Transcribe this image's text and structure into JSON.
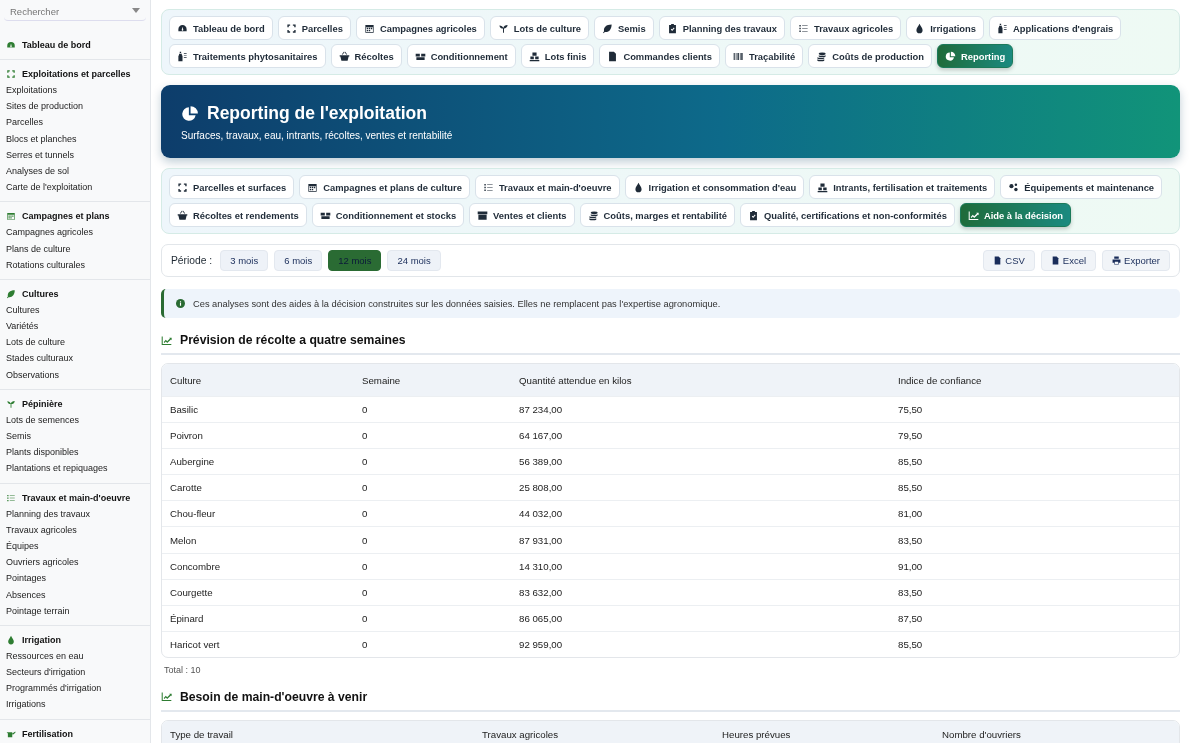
{
  "sidebar": {
    "search": {
      "placeholder": "Rechercher"
    },
    "sections": [
      {
        "title": "Tableau de bord"
      },
      {
        "title": "Exploitations et parcelles",
        "items": [
          "Exploitations",
          "Sites de production",
          "Parcelles",
          "Blocs et planches",
          "Serres et tunnels",
          "Analyses de sol",
          "Carte de l'exploitation"
        ]
      },
      {
        "title": "Campagnes et plans",
        "items": [
          "Campagnes agricoles",
          "Plans de culture",
          "Rotations culturales"
        ]
      },
      {
        "title": "Cultures",
        "items": [
          "Cultures",
          "Variétés",
          "Lots de culture",
          "Stades culturaux",
          "Observations"
        ]
      },
      {
        "title": "Pépinière",
        "items": [
          "Lots de semences",
          "Semis",
          "Plants disponibles",
          "Plantations et repiquages"
        ]
      },
      {
        "title": "Travaux et main-d'oeuvre",
        "items": [
          "Planning des travaux",
          "Travaux agricoles",
          "Équipes",
          "Ouvriers agricoles",
          "Pointages",
          "Absences",
          "Pointage terrain"
        ]
      },
      {
        "title": "Irrigation",
        "items": [
          "Ressources en eau",
          "Secteurs d'irrigation",
          "Programmés d'irrigation",
          "Irrigations"
        ]
      },
      {
        "title": "Fertilisation"
      }
    ]
  },
  "top_tabs": [
    {
      "label": "Tableau de bord",
      "selected": false
    },
    {
      "label": "Parcelles",
      "selected": false
    },
    {
      "label": "Campagnes agricoles",
      "selected": false
    },
    {
      "label": "Lots de culture",
      "selected": false
    },
    {
      "label": "Semis",
      "selected": false
    },
    {
      "label": "Planning des travaux",
      "selected": false
    },
    {
      "label": "Travaux agricoles",
      "selected": false
    },
    {
      "label": "Irrigations",
      "selected": false
    },
    {
      "label": "Applications d'engrais",
      "selected": false
    },
    {
      "label": "Traitements phytosanitaires",
      "selected": false
    },
    {
      "label": "Récoltes",
      "selected": false
    },
    {
      "label": "Conditionnement",
      "selected": false
    },
    {
      "label": "Lots finis",
      "selected": false
    },
    {
      "label": "Commandes clients",
      "selected": false
    },
    {
      "label": "Traçabilité",
      "selected": false
    },
    {
      "label": "Coûts de production",
      "selected": false
    },
    {
      "label": "Reporting",
      "selected": true
    }
  ],
  "header": {
    "title": "Reporting de l'exploitation",
    "subtitle": "Surfaces, travaux, eau, intrants, récoltes, ventes et rentabilité"
  },
  "report_tabs": [
    {
      "label": "Parcelles et surfaces",
      "selected": false
    },
    {
      "label": "Campagnes et plans de culture",
      "selected": false
    },
    {
      "label": "Travaux et main-d'oeuvre",
      "selected": false
    },
    {
      "label": "Irrigation et consommation d'eau",
      "selected": false
    },
    {
      "label": "Intrants, fertilisation et traitements",
      "selected": false
    },
    {
      "label": "Équipements et maintenance",
      "selected": false
    },
    {
      "label": "Récoltes et rendements",
      "selected": false
    },
    {
      "label": "Conditionnement et stocks",
      "selected": false
    },
    {
      "label": "Ventes et clients",
      "selected": false
    },
    {
      "label": "Coûts, marges et rentabilité",
      "selected": false
    },
    {
      "label": "Qualité, certifications et non-conformités",
      "selected": false
    },
    {
      "label": "Aide à la décision",
      "selected": true
    }
  ],
  "period": {
    "label": "Période :",
    "options": [
      {
        "label": "3 mois",
        "selected": false
      },
      {
        "label": "6 mois",
        "selected": false
      },
      {
        "label": "12 mois",
        "selected": true
      },
      {
        "label": "24 mois",
        "selected": false
      }
    ],
    "exports": [
      "CSV",
      "Excel",
      "Exporter"
    ]
  },
  "notice": "Ces analyses sont des aides à la décision construites sur les données saisies. Elles ne remplacent pas l'expertise agronomique.",
  "forecast": {
    "title": "Prévision de récolte a quatre semaines",
    "columns": [
      "Culture",
      "Semaine",
      "Quantité attendue en kilos",
      "Indice de confiance"
    ],
    "rows": [
      [
        "Basilic",
        "0",
        "87 234,00",
        "75,50"
      ],
      [
        "Poivron",
        "0",
        "64 167,00",
        "79,50"
      ],
      [
        "Aubergine",
        "0",
        "56 389,00",
        "85,50"
      ],
      [
        "Carotte",
        "0",
        "25 808,00",
        "85,50"
      ],
      [
        "Chou-fleur",
        "0",
        "44 032,00",
        "81,00"
      ],
      [
        "Melon",
        "0",
        "87 931,00",
        "83,50"
      ],
      [
        "Concombre",
        "0",
        "14 310,00",
        "91,00"
      ],
      [
        "Courgette",
        "0",
        "83 632,00",
        "83,50"
      ],
      [
        "Épinard",
        "0",
        "86 065,00",
        "87,50"
      ],
      [
        "Haricot vert",
        "0",
        "92 959,00",
        "85,50"
      ]
    ],
    "total": "Total : 10"
  },
  "labour": {
    "title": "Besoin de main-d'oeuvre à venir",
    "columns": [
      "Type de travail",
      "Travaux agricoles",
      "Heures prévues",
      "Nombre d'ouvriers"
    ]
  }
}
